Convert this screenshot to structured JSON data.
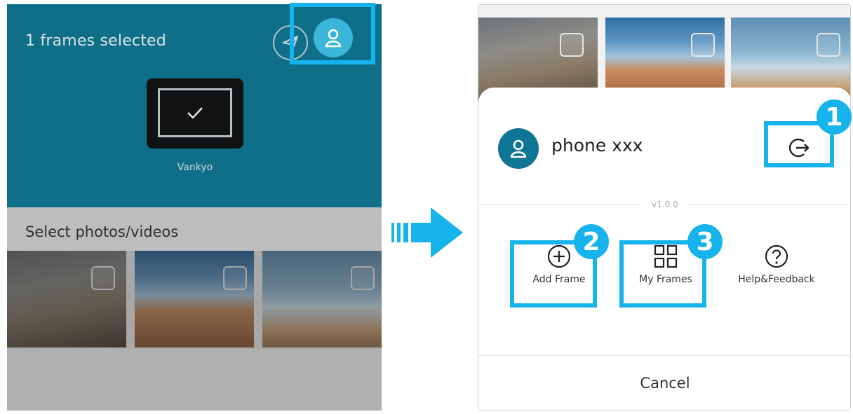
{
  "left_screen": {
    "header_title": "1 frames selected",
    "frame_name": "Vankyo",
    "section_label": "Select photos/videos",
    "icons": [
      "send-icon",
      "account-icon",
      "checkmark-icon"
    ]
  },
  "right_screen": {
    "user_name": "phone xxx",
    "version": "v1.0.0",
    "actions": [
      {
        "label": "Add Frame",
        "icon": "add-circle-icon"
      },
      {
        "label": "My Frames",
        "icon": "grid-icon"
      },
      {
        "label": "Help&Feedback",
        "icon": "help-icon"
      }
    ],
    "cancel_label": "Cancel"
  },
  "callouts": [
    "1",
    "2",
    "3"
  ],
  "colors": {
    "header_bg": "#0f6f89",
    "accent": "#3bb5d8",
    "highlight": "#17b3ec",
    "avatar_bg": "#0f7594"
  }
}
